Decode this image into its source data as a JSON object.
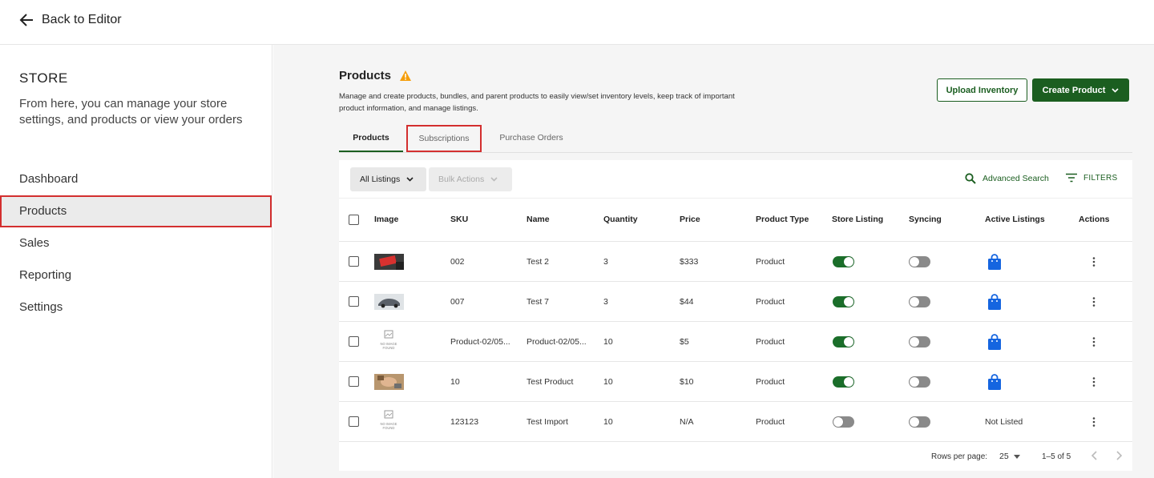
{
  "topbar": {
    "back_label": "Back to Editor"
  },
  "sidebar": {
    "title": "STORE",
    "description": "From here, you can manage your store settings, and products or view your orders",
    "items": [
      {
        "label": "Dashboard"
      },
      {
        "label": "Products",
        "active": true
      },
      {
        "label": "Sales"
      },
      {
        "label": "Reporting"
      },
      {
        "label": "Settings"
      }
    ]
  },
  "main": {
    "title": "Products",
    "description": "Manage and create products, bundles, and parent products to easily view/set inventory levels, keep track of important product information, and manage listings.",
    "upload_label": "Upload Inventory",
    "create_label": "Create Product",
    "tabs": [
      {
        "label": "Products"
      },
      {
        "label": "Subscriptions"
      },
      {
        "label": "Purchase Orders"
      }
    ]
  },
  "toolbar": {
    "listings_label": "All Listings",
    "bulk_label": "Bulk Actions",
    "advanced_search_label": "Advanced Search",
    "filters_label": "FILTERS"
  },
  "table": {
    "columns": [
      "Image",
      "SKU",
      "Name",
      "Quantity",
      "Price",
      "Product Type",
      "Store Listing",
      "Syncing",
      "Active Listings",
      "Actions"
    ],
    "rows": [
      {
        "image": "thumb-red",
        "sku": "002",
        "name": "Test 2",
        "quantity": "3",
        "price": "$333",
        "type": "Product",
        "store_listing": true,
        "syncing": false,
        "active": "bag"
      },
      {
        "image": "thumb-car",
        "sku": "007",
        "name": "Test 7",
        "quantity": "3",
        "price": "$44",
        "type": "Product",
        "store_listing": true,
        "syncing": false,
        "active": "bag"
      },
      {
        "image": "no-image",
        "sku": "Product-02/05...",
        "name": "Product-02/05...",
        "quantity": "10",
        "price": "$5",
        "type": "Product",
        "store_listing": true,
        "syncing": false,
        "active": "bag"
      },
      {
        "image": "thumb-hand",
        "sku": "10",
        "name": "Test Product",
        "quantity": "10",
        "price": "$10",
        "type": "Product",
        "store_listing": true,
        "syncing": false,
        "active": "bag"
      },
      {
        "image": "no-image",
        "sku": "123123",
        "name": "Test Import",
        "quantity": "10",
        "price": "N/A",
        "type": "Product",
        "store_listing": false,
        "syncing": false,
        "active": "Not Listed"
      }
    ],
    "no_image_text": [
      "NO IMAGE",
      "FOUND"
    ]
  },
  "pagination": {
    "rows_per_page_label": "Rows per page:",
    "rows_per_page_value": "25",
    "range_label": "1–5 of 5"
  },
  "colors": {
    "accent": "#1b5e20",
    "toggle_on": "#1b6e2a",
    "highlight": "#d32f2f",
    "bag": "#1565e0"
  }
}
